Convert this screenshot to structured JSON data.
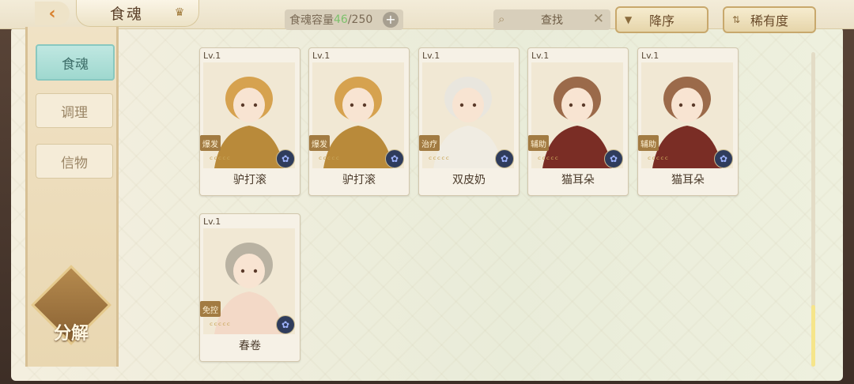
{
  "header": {
    "back_icon": "chevron-left-icon",
    "title": "食魂",
    "crown_icon": "crown-icon",
    "capacity_label": "食魂容量 ",
    "capacity_current": "46",
    "capacity_max": "/250",
    "add_label": "+",
    "search_placeholder": "查找",
    "search_clear": "✕",
    "sort_order_label": "降序",
    "sort_key_label": "稀有度"
  },
  "sidebar": {
    "tabs": [
      {
        "label": "食魂",
        "active": true
      },
      {
        "label": "调理",
        "active": false
      },
      {
        "label": "信物",
        "active": false
      }
    ],
    "decompose_label": "分解"
  },
  "cards": [
    {
      "level": "Lv.1",
      "role": "爆发",
      "name": "驴打滚",
      "stars": "ᶜᶜᶜᶜᶜ",
      "hair": "#d6a24f",
      "outfit": "#b98a3a"
    },
    {
      "level": "Lv.1",
      "role": "爆发",
      "name": "驴打滚",
      "stars": "ᶜᶜᶜᶜᶜ",
      "hair": "#d6a24f",
      "outfit": "#b98a3a"
    },
    {
      "level": "Lv.1",
      "role": "治疗",
      "name": "双皮奶",
      "stars": "ᶜᶜᶜᶜᶜ",
      "hair": "#e9e6de",
      "outfit": "#f0ece2"
    },
    {
      "level": "Lv.1",
      "role": "辅助",
      "name": "猫耳朵",
      "stars": "ᶜᶜᶜᶜᶜ",
      "hair": "#9b6a4a",
      "outfit": "#7a2d25"
    },
    {
      "level": "Lv.1",
      "role": "辅助",
      "name": "猫耳朵",
      "stars": "ᶜᶜᶜᶜᶜ",
      "hair": "#9b6a4a",
      "outfit": "#7a2d25"
    },
    {
      "level": "Lv.1",
      "role": "免控",
      "name": "春卷",
      "stars": "ᶜᶜᶜᶜᶜ",
      "hair": "#b9b2a2",
      "outfit": "#f3d9c7"
    }
  ]
}
